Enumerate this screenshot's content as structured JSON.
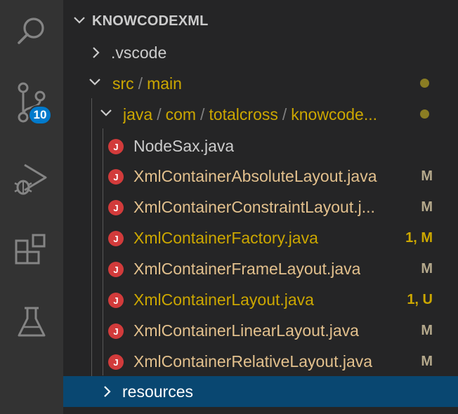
{
  "colors": {
    "activity_bar_bg": "#333333",
    "sidebar_bg": "#252526",
    "badge_bg": "#007acc",
    "selected_bg": "#094771",
    "java_icon": "#d23b3b",
    "modified_text": "#e2c08d",
    "error_text": "#cca700",
    "folder_dot": "#8a7d23"
  },
  "activity_bar": {
    "items": [
      {
        "name": "search",
        "icon": "search-icon"
      },
      {
        "name": "source-control",
        "icon": "source-control-icon",
        "badge": "10"
      },
      {
        "name": "run-and-debug",
        "icon": "debug-icon"
      },
      {
        "name": "extensions",
        "icon": "extensions-icon"
      },
      {
        "name": "testing",
        "icon": "flask-icon"
      }
    ]
  },
  "explorer": {
    "section_title": "KNOWCODEXML",
    "tree": {
      "vscode": {
        "label": ".vscode"
      },
      "src_main": {
        "part1": "src",
        "sep": "/",
        "part2": "main"
      },
      "java_path": {
        "p1": "java",
        "sep1": "/",
        "p2": "com",
        "sep2": "/",
        "p3": "totalcross",
        "sep3": "/",
        "p4": "knowcode..."
      },
      "files": [
        {
          "label": "NodeSax.java",
          "status": "",
          "color": "default"
        },
        {
          "label": "XmlContainerAbsoluteLayout.java",
          "status": "M",
          "color": "modified"
        },
        {
          "label": "XmlContainerConstraintLayout.j...",
          "status": "M",
          "color": "modified"
        },
        {
          "label": "XmlContainerFactory.java",
          "status": "1, M",
          "color": "error"
        },
        {
          "label": "XmlContainerFrameLayout.java",
          "status": "M",
          "color": "modified"
        },
        {
          "label": "XmlContainerLayout.java",
          "status": "1, U",
          "color": "error"
        },
        {
          "label": "XmlContainerLinearLayout.java",
          "status": "M",
          "color": "modified"
        },
        {
          "label": "XmlContainerRelativeLayout.java",
          "status": "M",
          "color": "modified"
        }
      ],
      "resources": {
        "label": "resources"
      }
    },
    "java_icon_letter": "J"
  }
}
